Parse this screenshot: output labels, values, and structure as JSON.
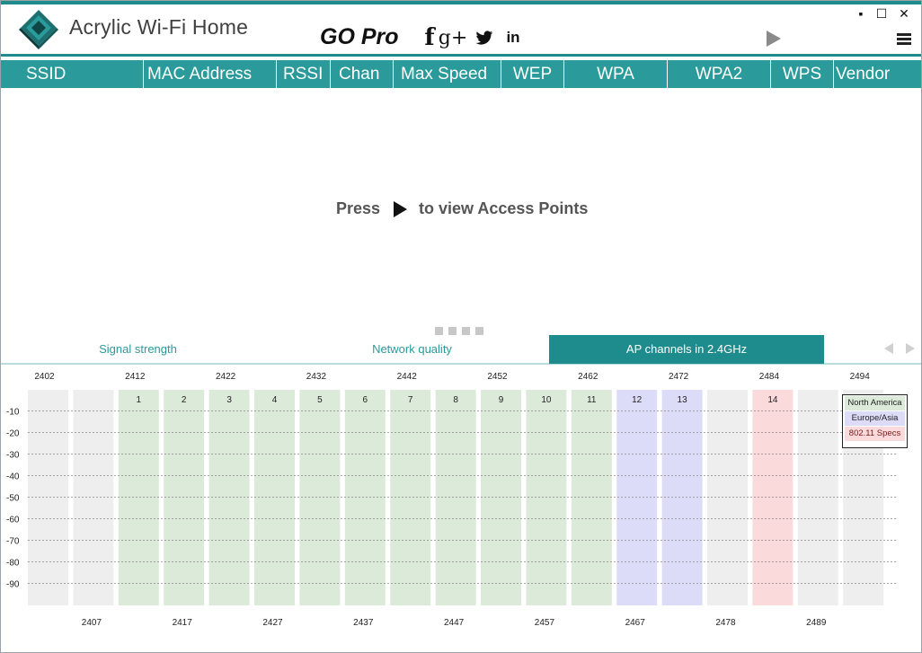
{
  "app": {
    "title": "Acrylic Wi-Fi Home",
    "go_pro_label": "GO Pro",
    "social_icons": [
      "facebook-icon",
      "google-plus-icon",
      "twitter-icon",
      "linkedin-icon"
    ],
    "social_glyphs": {
      "facebook": "f",
      "google_plus": "g+",
      "linkedin": "in"
    },
    "window_controls": {
      "minimize": "▪",
      "maximize": "☐",
      "close": "✕"
    },
    "accent_color": "#1e8c8c"
  },
  "columns": [
    "SSID",
    "MAC Address",
    "RSSI",
    "Chan",
    "Max Speed",
    "WEP",
    "WPA",
    "WPA2",
    "WPS",
    "Vendor"
  ],
  "prompt": {
    "before": "Press",
    "after": "to view Access Points"
  },
  "tabs": [
    {
      "label": "Signal strength",
      "active": false
    },
    {
      "label": "Network quality",
      "active": false
    },
    {
      "label": "AP channels in 2.4GHz",
      "active": true
    }
  ],
  "chart_data": {
    "type": "bar",
    "title": "",
    "top_ticks": [
      2402,
      2412,
      2422,
      2432,
      2442,
      2452,
      2462,
      2472,
      2484,
      2494
    ],
    "bottom_ticks": [
      2407,
      2417,
      2427,
      2437,
      2447,
      2457,
      2467,
      2478,
      2489
    ],
    "y_ticks": [
      -10,
      -20,
      -30,
      -40,
      -50,
      -60,
      -70,
      -80,
      -90
    ],
    "ylim": [
      -100,
      0
    ],
    "grid": true,
    "slots": [
      {
        "label": "",
        "region": "none"
      },
      {
        "label": "",
        "region": "none"
      },
      {
        "label": "1",
        "region": "north_america"
      },
      {
        "label": "2",
        "region": "north_america"
      },
      {
        "label": "3",
        "region": "north_america"
      },
      {
        "label": "4",
        "region": "north_america"
      },
      {
        "label": "5",
        "region": "north_america"
      },
      {
        "label": "6",
        "region": "north_america"
      },
      {
        "label": "7",
        "region": "north_america"
      },
      {
        "label": "8",
        "region": "north_america"
      },
      {
        "label": "9",
        "region": "north_america"
      },
      {
        "label": "10",
        "region": "north_america"
      },
      {
        "label": "11",
        "region": "north_america"
      },
      {
        "label": "12",
        "region": "europe_asia"
      },
      {
        "label": "13",
        "region": "europe_asia"
      },
      {
        "label": "",
        "region": "none"
      },
      {
        "label": "14",
        "region": "spec"
      },
      {
        "label": "",
        "region": "none"
      },
      {
        "label": "",
        "region": "none"
      }
    ],
    "region_colors": {
      "none": "#eeeeee",
      "north_america": "#dcebd9",
      "europe_asia": "#dcdcf8",
      "spec": "#fadada"
    },
    "legend": [
      {
        "label": "North America",
        "color": "#dcebd9"
      },
      {
        "label": "Europe/Asia",
        "color": "#dcdcf8"
      },
      {
        "label": "802.11 Specs",
        "color": "#fadada"
      }
    ],
    "legend_position": "top-right"
  }
}
